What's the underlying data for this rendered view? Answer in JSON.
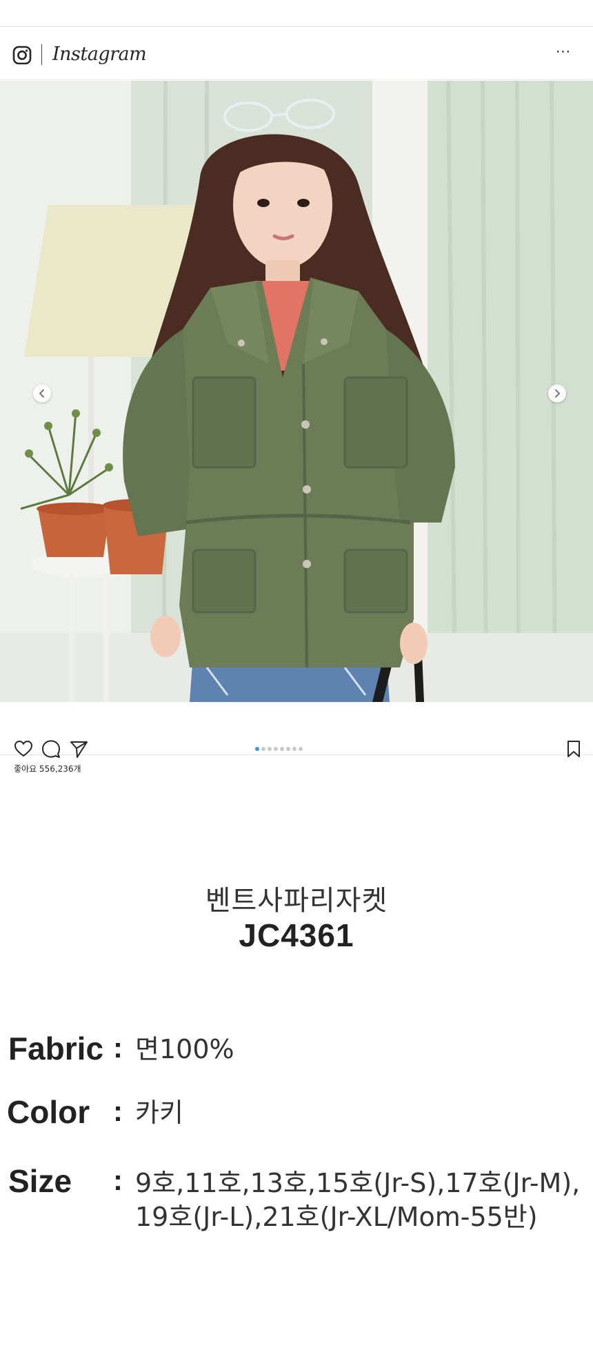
{
  "header": {
    "brand_name": "Instagram",
    "more_label": "···"
  },
  "post": {
    "likes_text": "좋아요 556,236개",
    "carousel": {
      "total_slides": 8,
      "active_slide": 1
    }
  },
  "product": {
    "name": "벤트사파리자켓",
    "code": "JC4361"
  },
  "specs": {
    "fabric": {
      "label": "Fabric",
      "colon": ":",
      "value": "면100%"
    },
    "color": {
      "label": "Color",
      "colon": ":",
      "value": "카키"
    },
    "size": {
      "label": "Size",
      "colon": ":",
      "value_line1": "9호,11호,13호,15호(Jr-S),17호(Jr-M),",
      "value_line2": "19호(Jr-L),21호(Jr-XL/Mom-55반)"
    }
  },
  "colors": {
    "accent_blue": "#3897f0",
    "jacket_khaki": "#6b7c56"
  }
}
